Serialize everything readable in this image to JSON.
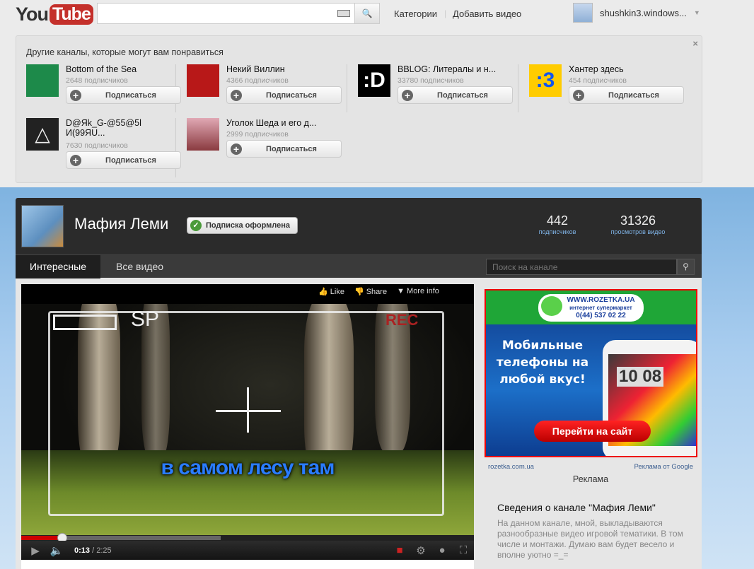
{
  "header": {
    "logo": {
      "you": "You",
      "tube": "Tube"
    },
    "search_value": "",
    "nav": [
      "Категории",
      "Добавить видео"
    ],
    "user": "shushkin3.windows..."
  },
  "recommendations": {
    "title": "Другие каналы, которые могут вам понравиться",
    "subscribe_label": "Подписаться",
    "channels": [
      {
        "name": "Bottom of the Sea",
        "subs": "2648 подписчиков",
        "thumb_color": "#1d8a4a"
      },
      {
        "name": "Некий Виллин",
        "subs": "4366 подписчиков",
        "thumb_color": "#b81818"
      },
      {
        "name": "BBLOG: Литералы и н...",
        "subs": "33780 подписчиков",
        "thumb_color": "#000000"
      },
      {
        "name": "Хантер здесь",
        "subs": "454 подписчиков",
        "thumb_color": "#ffcc00"
      },
      {
        "name": "D@Яk_G-@55@5lИ(99ЯU...",
        "subs": "7630 подписчиков",
        "thumb_color": "#222222"
      },
      {
        "name": "Уголок Шеда и его д...",
        "subs": "2999 подписчиков",
        "thumb_color": "#c98a94"
      }
    ]
  },
  "channel": {
    "title": "Мафия Леми",
    "subscribed_label": "Подписка оформлена",
    "stats": [
      {
        "value": "442",
        "label": "подписчиков"
      },
      {
        "value": "31326",
        "label": "просмотров видео"
      }
    ],
    "tabs": [
      {
        "label": "Интересные",
        "active": true
      },
      {
        "label": "Все видео",
        "active": false
      }
    ],
    "search_placeholder": "Поиск на канале"
  },
  "video": {
    "overlay": {
      "like": "Like",
      "share": "Share",
      "more": "More info"
    },
    "hud": {
      "sp": "SP",
      "rec": "REC"
    },
    "subtitle": "в самом лесу там",
    "current": "0:13",
    "duration": "/ 2:25",
    "progress_fraction": 0.09,
    "buffered_fraction": 0.44
  },
  "ad": {
    "url": "WWW.ROZETKA.UA",
    "slogan": "интернет супермаркет",
    "phone": "0(44) 537 02 22",
    "headline": "Мобильные телефоны на любой вкус!",
    "clock": "10 08",
    "cta": "Перейти на сайт",
    "domain": "rozetka.com.ua",
    "by_google": "Реклама от Google",
    "label": "Реклама"
  },
  "about": {
    "title": "Сведения о канале \"Мафия Леми\"",
    "text": "На данном канале, мной, выкладываются разнообразные видео игровой тематики. В том числе и монтажи. Думаю вам будет весело и вполне уютно =_="
  }
}
